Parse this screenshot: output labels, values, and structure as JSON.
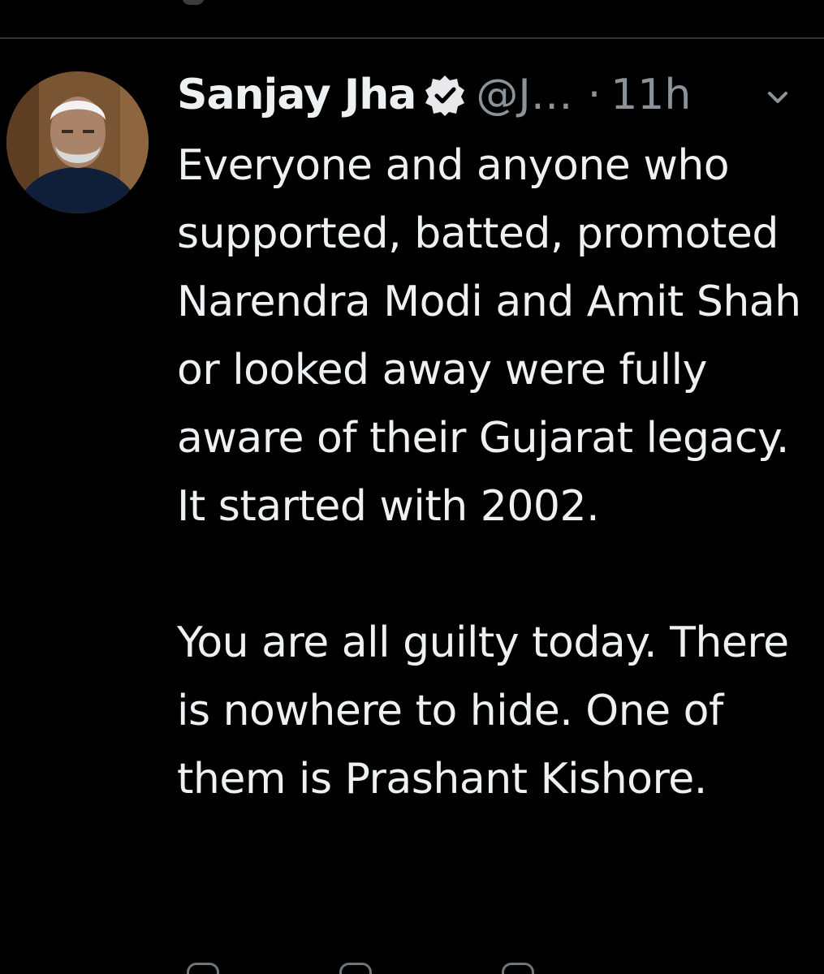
{
  "tweet": {
    "author": {
      "display_name": "Sanjay Jha",
      "handle": "@J…",
      "verified": true
    },
    "separator": "·",
    "timestamp": "11h",
    "text": "Everyone and anyone who supported, batted, promoted Narendra Modi and Amit Shah or looked away were fully aware of their Gujarat legacy. It started with 2002.\n\nYou are all guilty today. There is nowhere to hide. One of them is Prashant Kishore."
  },
  "icons": {
    "verified": "verified-badge-icon",
    "more": "chevron-down-icon",
    "reply": "reply-icon",
    "retweet": "retweet-icon",
    "like": "like-icon"
  },
  "colors": {
    "background": "#000000",
    "primary_text": "#e7e9ea",
    "secondary_text": "#8b9399",
    "divider": "#2f3336"
  }
}
